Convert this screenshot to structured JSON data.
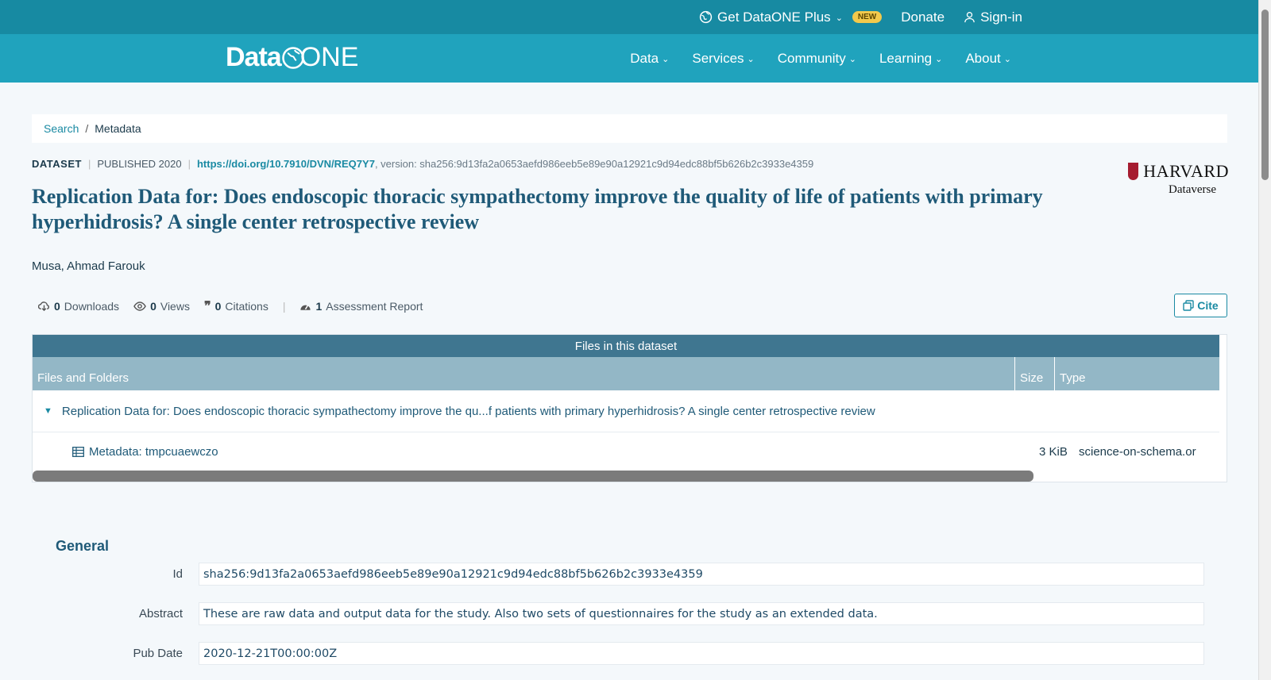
{
  "topbar": {
    "plus_label": "Get DataONE Plus",
    "new_badge": "NEW",
    "donate_label": "Donate",
    "signin_label": "Sign-in"
  },
  "nav": {
    "logo_text_a": "Data",
    "logo_text_b": "ONE",
    "items": [
      {
        "label": "Data"
      },
      {
        "label": "Services"
      },
      {
        "label": "Community"
      },
      {
        "label": "Learning"
      },
      {
        "label": "About"
      }
    ]
  },
  "breadcrumb": {
    "search": "Search",
    "sep": "/",
    "current": "Metadata"
  },
  "dataset": {
    "kind": "DATASET",
    "published": "PUBLISHED 2020",
    "doi": "https://doi.org/10.7910/DVN/REQ7Y7",
    "version": ", version: sha256:9d13fa2a0653aefd986eeb5e89e90a12921c9d94edc88bf5b626b2c3933e4359",
    "title": "Replication Data for: Does endoscopic thoracic sympathectomy improve the quality of life of patients with primary hyperhidrosis? A single center retrospective review",
    "author": "Musa, Ahmad Farouk"
  },
  "repository": {
    "name": "HARVARD",
    "sub": "Dataverse"
  },
  "metrics": {
    "downloads_count": "0",
    "downloads_label": "Downloads",
    "views_count": "0",
    "views_label": "Views",
    "citations_count": "0",
    "citations_label": "Citations",
    "assessment_count": "1",
    "assessment_label": "Assessment Report",
    "cite_label": "Cite"
  },
  "files": {
    "header": "Files in this dataset",
    "columns": [
      "Files and Folders",
      "Size",
      "Type"
    ],
    "folder": "Replication Data for: Does endoscopic thoracic sympathectomy improve the qu...f patients with primary hyperhidrosis? A single center retrospective review",
    "file": {
      "name": "Metadata: tmpcuaewczo",
      "size": "3 KiB",
      "type": "science-on-schema.or"
    }
  },
  "general": {
    "heading": "General",
    "fields": [
      {
        "label": "Id",
        "value": "sha256:9d13fa2a0653aefd986eeb5e89e90a12921c9d94edc88bf5b626b2c3933e4359"
      },
      {
        "label": "Abstract",
        "value": "These are raw data and output data for the study. Also two sets of questionnaires for the study as an extended data."
      },
      {
        "label": "Pub Date",
        "value": "2020-12-21T00:00:00Z"
      }
    ]
  }
}
